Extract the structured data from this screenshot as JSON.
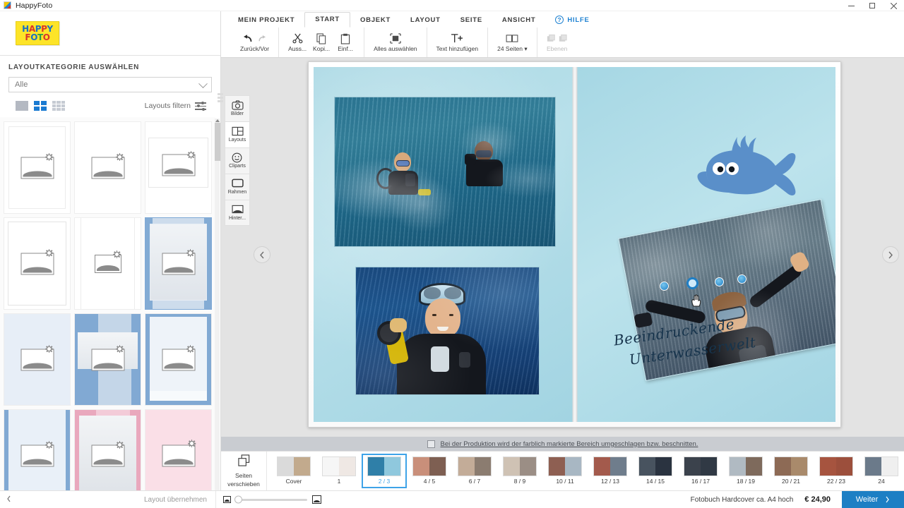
{
  "window": {
    "title": "HappyFoto",
    "app_icon": "happyfoto-logo-icon",
    "minimize": "–",
    "maximize": "□",
    "close": "✕"
  },
  "brand": {
    "line1": [
      "H",
      "A",
      "P",
      "P",
      "Y"
    ],
    "line2": [
      "F",
      "O",
      "T",
      "O"
    ]
  },
  "ribbon": {
    "tabs": [
      {
        "label": "MEIN PROJEKT",
        "active": false
      },
      {
        "label": "START",
        "active": true
      },
      {
        "label": "OBJEKT",
        "active": false
      },
      {
        "label": "LAYOUT",
        "active": false
      },
      {
        "label": "SEITE",
        "active": false
      },
      {
        "label": "ANSICHT",
        "active": false
      }
    ],
    "help": {
      "label": "HILFE",
      "mark": "?"
    },
    "buttons": [
      {
        "label": "Zurück/Vor",
        "icon": "undo-redo-icon",
        "disabled": false
      },
      {
        "label": "Auss...",
        "icon": "scissors-icon",
        "disabled": false
      },
      {
        "label": "Kopi...",
        "icon": "copy-icon",
        "disabled": false
      },
      {
        "label": "Einf...",
        "icon": "paste-icon",
        "disabled": false
      },
      {
        "label": "Alles auswählen",
        "icon": "select-all-icon",
        "disabled": false
      },
      {
        "label": "Text hinzufügen",
        "icon": "add-text-icon",
        "disabled": false
      },
      {
        "label": "24 Seiten ▾",
        "icon": "book-pages-icon",
        "disabled": false
      },
      {
        "label": "Ebenen",
        "icon": "layers-icon",
        "disabled": true
      }
    ]
  },
  "sidebar": {
    "title": "LAYOUTKATEGORIE AUSWÄHLEN",
    "category_select": {
      "value": "Alle",
      "chevron": "chevron-down-icon"
    },
    "view_modes": [
      {
        "name": "single-column-view",
        "active": false
      },
      {
        "name": "two-column-view",
        "active": true
      },
      {
        "name": "three-column-view",
        "active": false
      }
    ],
    "filter_label": "Layouts filtern",
    "filter_icon": "sliders-icon",
    "layouts": [
      {
        "id": 1,
        "style": "plain",
        "selected": false
      },
      {
        "id": 2,
        "style": "plain-wide",
        "selected": false
      },
      {
        "id": 3,
        "style": "plain-inset",
        "selected": false
      },
      {
        "id": 4,
        "style": "plain-border",
        "selected": false
      },
      {
        "id": 5,
        "style": "plain-narrow",
        "selected": false
      },
      {
        "id": 6,
        "style": "blue-frame",
        "selected": true
      },
      {
        "id": 7,
        "style": "pale-blue",
        "selected": false
      },
      {
        "id": 8,
        "style": "blue-bands",
        "selected": false
      },
      {
        "id": 9,
        "style": "blue-edge",
        "selected": false
      },
      {
        "id": 10,
        "style": "blue-sides",
        "selected": false
      },
      {
        "id": 11,
        "style": "pink-frame",
        "selected": false
      },
      {
        "id": 12,
        "style": "pale-pink",
        "selected": false
      }
    ]
  },
  "palette": {
    "tools": [
      {
        "label": "Bilder",
        "icon": "camera-icon",
        "active": false
      },
      {
        "label": "Layouts",
        "icon": "layout-grid-icon",
        "active": true
      },
      {
        "label": "Cliparts",
        "icon": "smiley-icon",
        "active": false
      },
      {
        "label": "Rahmen",
        "icon": "frame-icon",
        "active": false
      },
      {
        "label": "Hinter...",
        "icon": "background-icon",
        "active": false
      }
    ]
  },
  "canvas": {
    "prev_arrow": "chevron-left-icon",
    "next_arrow": "chevron-right-icon",
    "page_caption_line1": "Beeindruckende",
    "page_caption_line2": "Unterwasserwelt",
    "clipart": "whale-clipart",
    "photos": [
      {
        "name": "photo-divers-surface",
        "page": "left",
        "rotation": 0
      },
      {
        "name": "photo-diver-portrait",
        "page": "left",
        "rotation": 0
      },
      {
        "name": "photo-diver-arms-up",
        "page": "right",
        "rotation": -11,
        "selected": true
      }
    ]
  },
  "production_note": {
    "checkbox_checked": false,
    "text": "Bei der Produktion wird der farblich markierte Bereich umgeschlagen bzw. beschnitten."
  },
  "pagestrip": {
    "move_pages_line1": "Seiten",
    "move_pages_line2": "verschieben",
    "move_pages_icon": "move-pages-icon",
    "pages": [
      {
        "label": "Cover",
        "selected": false,
        "left": "#d9d9d9",
        "right": "#c9b49a"
      },
      {
        "label": "1",
        "selected": false,
        "left": "#f4f4f4",
        "right": "#e6e6e6"
      },
      {
        "label": "2 / 3",
        "selected": true,
        "left": "#2f7fa8",
        "right": "#8fc8dd"
      },
      {
        "label": "4 / 5",
        "selected": false,
        "left": "#c7a79a",
        "right": "#9a6b5c"
      },
      {
        "label": "6 / 7",
        "selected": false,
        "left": "#b8a294",
        "right": "#7f7166"
      },
      {
        "label": "8 / 9",
        "selected": false,
        "left": "#cfc3b6",
        "right": "#9c8f86"
      },
      {
        "label": "10 / 11",
        "selected": false,
        "left": "#8e5f52",
        "right": "#a8b7c3"
      },
      {
        "label": "12 / 13",
        "selected": false,
        "left": "#a35a4c",
        "right": "#6f7d8c"
      },
      {
        "label": "14 / 15",
        "selected": false,
        "left": "#3e4a57",
        "right": "#2a3340"
      },
      {
        "label": "16 / 17",
        "selected": false,
        "left": "#3b424c",
        "right": "#2d3views"
      },
      {
        "label": "18 / 19",
        "selected": false,
        "left": "#a9b4bd",
        "right": "#7e6a5c"
      },
      {
        "label": "20 / 21",
        "selected": false,
        "left": "#8d6a55",
        "right": "#a98a6b"
      },
      {
        "label": "22 / 23",
        "selected": false,
        "left": "#a6543f",
        "right": "#9c4f3c"
      },
      {
        "label": "24",
        "selected": false,
        "left": "#6b7a8a",
        "right": "#efefef"
      }
    ]
  },
  "statusbar": {
    "collapse_icon": "chevron-left-icon",
    "apply_layout": "Layout übernehmen",
    "zoom_small_icon": "zoom-small-icon",
    "zoom_large_icon": "zoom-large-icon",
    "zoom_value": 0,
    "product": "Fotobuch Hardcover ca. A4 hoch",
    "price": "€ 24,90",
    "next_label": "Weiter",
    "next_chevron": "chevron-right-icon"
  },
  "colors": {
    "accent": "#1d7fc4",
    "selection": "#3ea3e8",
    "canvas_bg": "#e3e3e3",
    "page_bg": "#ace0ec"
  }
}
